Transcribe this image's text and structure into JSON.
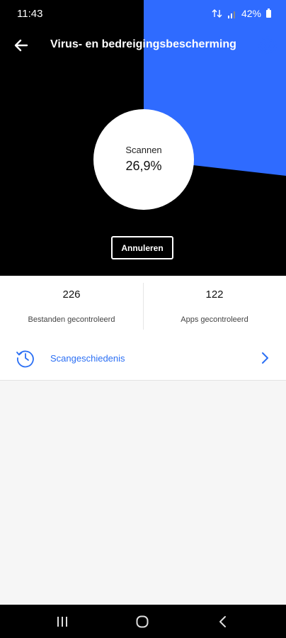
{
  "status_bar": {
    "time": "11:43",
    "battery": "42%"
  },
  "toolbar": {
    "title": "Virus- en bedreigingsbescherming",
    "back_icon": "arrow-left-icon",
    "settings_icon": "gear-icon"
  },
  "scan": {
    "label": "Scannen",
    "progress_text": "26,9%",
    "progress_value": 26.9,
    "cancel_label": "Annuleren"
  },
  "stats": [
    {
      "value": "226",
      "label": "Bestanden gecontroleerd"
    },
    {
      "value": "122",
      "label": "Apps gecontroleerd"
    }
  ],
  "history": {
    "label": "Scangeschiedenis",
    "icon": "history-clock-icon"
  },
  "colors": {
    "accent": "#2b6ff4",
    "hero_bg": "#000000",
    "progress_fill": "#2f6bff"
  }
}
